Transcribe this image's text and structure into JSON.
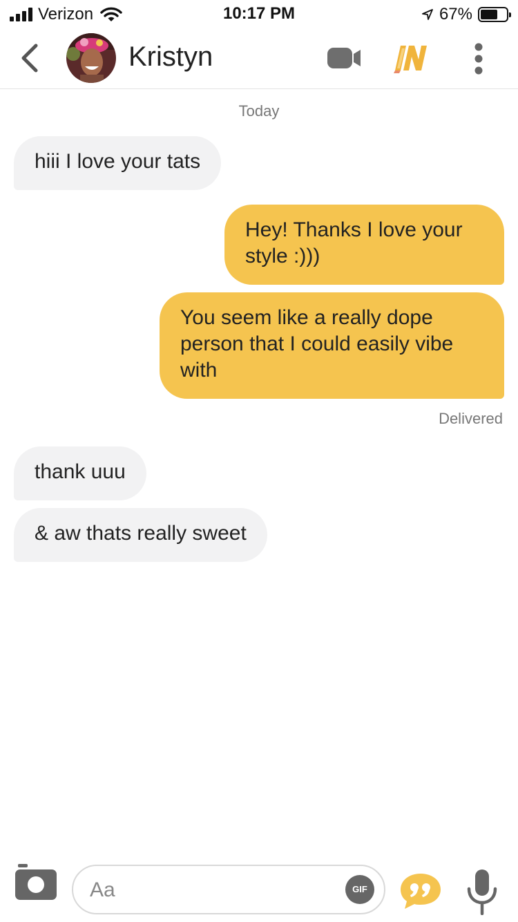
{
  "status_bar": {
    "carrier": "Verizon",
    "time": "10:17 PM",
    "battery": "67%",
    "battery_level": 0.67,
    "icons": [
      "signal-icon",
      "wifi-icon",
      "location-arrow-icon",
      "battery-icon"
    ]
  },
  "header": {
    "contact_name": "Kristyn",
    "icons": [
      "back-chevron-icon",
      "video-camera-icon",
      "in-badge-icon",
      "more-vertical-icon"
    ]
  },
  "conversation": {
    "date_label": "Today",
    "messages": [
      {
        "direction": "incoming",
        "text": "hiii I love your tats"
      },
      {
        "direction": "outgoing",
        "text": "Hey! Thanks I love your style :)))"
      },
      {
        "direction": "outgoing",
        "text": "You seem like a really dope person that I could easily vibe with"
      },
      {
        "direction": "incoming",
        "text": "thank uuu"
      },
      {
        "direction": "incoming",
        "text": "& aw thats really sweet"
      }
    ],
    "delivery_status": "Delivered"
  },
  "composer": {
    "placeholder": "Aa",
    "value": "",
    "gif_label": "GIF",
    "icons": [
      "camera-icon",
      "quote-icon",
      "microphone-icon"
    ]
  },
  "colors": {
    "accent": "#f5c44f",
    "incoming_bubble": "#f2f2f3",
    "text": "#222222",
    "muted": "#777777"
  }
}
